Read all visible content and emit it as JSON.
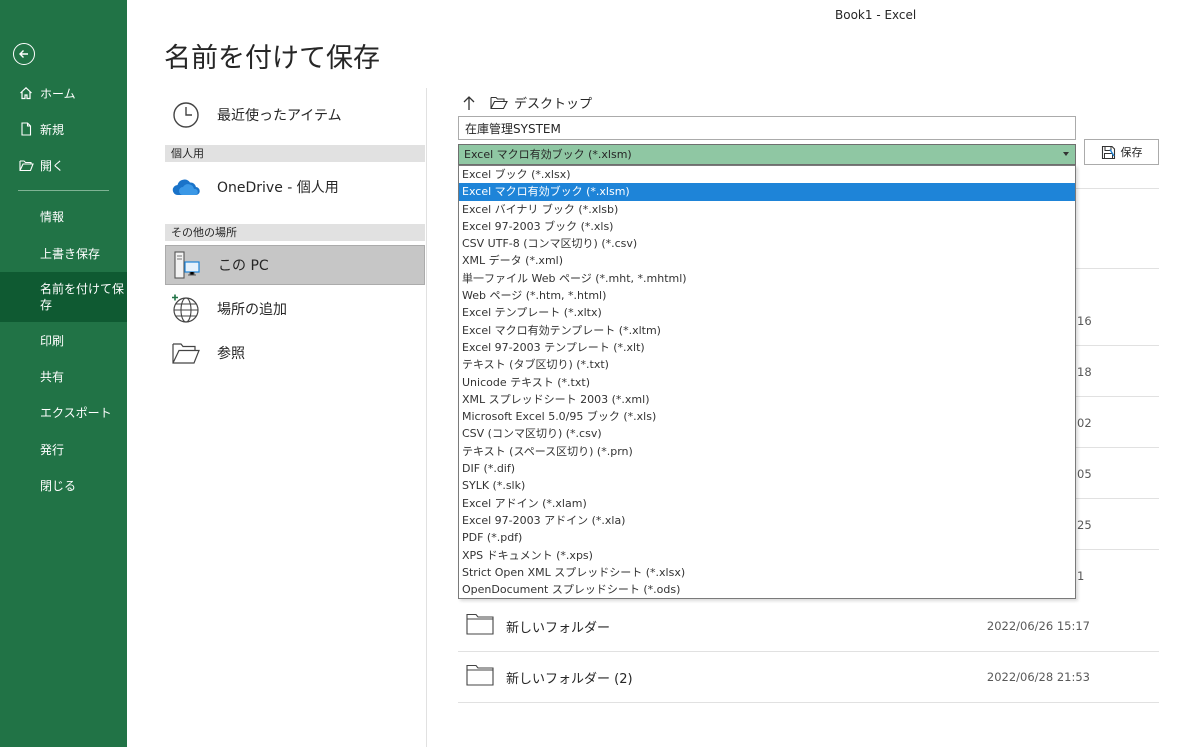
{
  "window": {
    "title": "Book1  -  Excel"
  },
  "sidebar": {
    "items": [
      {
        "label": "ホーム",
        "icon": "home-icon"
      },
      {
        "label": "新規",
        "icon": "new-file-icon"
      },
      {
        "label": "開く",
        "icon": "folder-open-icon"
      },
      {
        "label": "情報"
      },
      {
        "label": "上書き保存"
      },
      {
        "label": "名前を付けて保\n存",
        "active": true
      },
      {
        "label": "印刷"
      },
      {
        "label": "共有"
      },
      {
        "label": "エクスポート"
      },
      {
        "label": "発行"
      },
      {
        "label": "閉じる"
      }
    ]
  },
  "page": {
    "title": "名前を付けて保存"
  },
  "locations": {
    "recent": "最近使ったアイテム",
    "personal_header": "個人用",
    "onedrive": "OneDrive - 個人用",
    "other_header": "その他の場所",
    "this_pc": "この PC",
    "add_place": "場所の追加",
    "browse": "参照"
  },
  "save_pane": {
    "current_folder": "デスクトップ",
    "filename": "在庫管理SYSTEM",
    "filetype": "Excel マクロ有効ブック (*.xlsm)",
    "save_label": "保存"
  },
  "filetype_options": [
    "Excel ブック (*.xlsx)",
    "Excel マクロ有効ブック (*.xlsm)",
    "Excel バイナリ ブック (*.xlsb)",
    "Excel 97-2003 ブック (*.xls)",
    "CSV UTF-8 (コンマ区切り) (*.csv)",
    "XML データ (*.xml)",
    "単一ファイル Web ページ (*.mht, *.mhtml)",
    "Web ページ (*.htm, *.html)",
    "Excel テンプレート (*.xltx)",
    "Excel マクロ有効テンプレート (*.xltm)",
    "Excel 97-2003 テンプレート (*.xlt)",
    "テキスト (タブ区切り) (*.txt)",
    "Unicode テキスト (*.txt)",
    "XML スプレッドシート 2003 (*.xml)",
    "Microsoft Excel 5.0/95 ブック (*.xls)",
    "CSV (コンマ区切り) (*.csv)",
    "テキスト (スペース区切り) (*.prn)",
    "DIF (*.dif)",
    "SYLK (*.slk)",
    "Excel アドイン (*.xlam)",
    "Excel 97-2003 アドイン (*.xla)",
    "PDF (*.pdf)",
    "XPS ドキュメント (*.xps)",
    "Strict Open XML スプレッドシート (*.xlsx)",
    "OpenDocument スプレッドシート (*.ods)"
  ],
  "selected_filetype_index": 1,
  "partial_dates": [
    "16",
    "18",
    "02",
    "05",
    "25",
    "1"
  ],
  "files": [
    {
      "name": "新しいフォルダー",
      "date": "2022/06/26 15:17"
    },
    {
      "name": "新しいフォルダー (2)",
      "date": "2022/06/28 21:53"
    }
  ],
  "colors": {
    "sidebar": "#217346",
    "sidebar_active": "#0f5a32",
    "select_bg": "#8fc7a3",
    "highlight": "#1e84d8"
  }
}
